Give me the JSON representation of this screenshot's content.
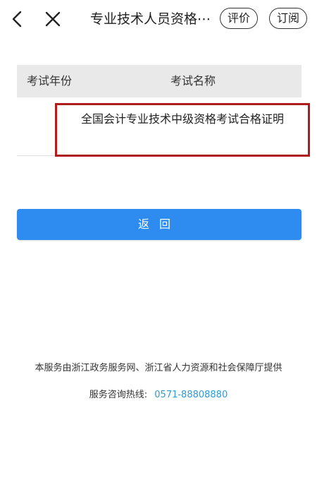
{
  "header": {
    "title": "专业技术人员资格⋯",
    "rate_label": "评价",
    "subscribe_label": "订阅",
    "back_icon": "chevron-left-icon",
    "close_icon": "close-icon"
  },
  "table": {
    "headers": [
      "考试年份",
      "考试名称"
    ],
    "rows": [
      {
        "year": "",
        "name": "全国会计专业技术中级资格考试合格证明"
      }
    ]
  },
  "actions": {
    "return_label": "返回"
  },
  "footer": {
    "provider_text": "本服务由浙江政务服务网、浙江省人力资源和社会保障厅提供",
    "hotline_label": "服务咨询热线:",
    "hotline_number": "0571-88808880"
  },
  "colors": {
    "primary_button": "#2e8cf0",
    "highlight_border": "#b01b1b",
    "hotline": "#2c9bd4"
  }
}
